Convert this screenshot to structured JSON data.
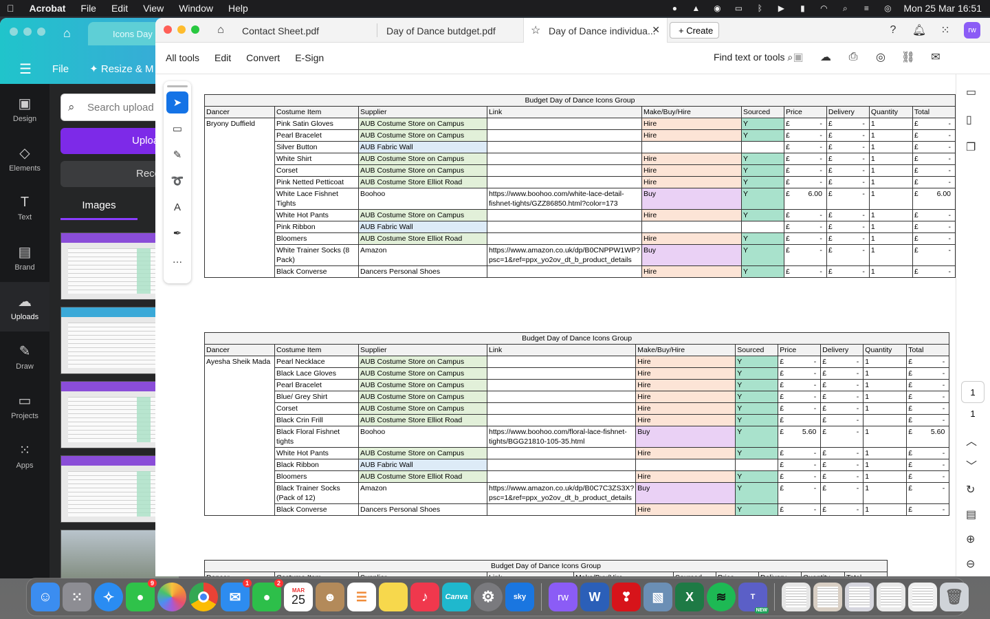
{
  "menubar": {
    "apple": "",
    "app": "Acrobat",
    "items": [
      "File",
      "Edit",
      "View",
      "Window",
      "Help"
    ],
    "datetime": "Mon 25 Mar  16:51"
  },
  "canva": {
    "tab": "Icons Day",
    "file": "File",
    "resize": "Resize & M",
    "search_placeholder": "Search upload",
    "upload": "Uploa",
    "record": "Reco",
    "images_tab": "Images",
    "sidebar": [
      {
        "label": "Design",
        "icon": "design-icon"
      },
      {
        "label": "Elements",
        "icon": "elements-icon"
      },
      {
        "label": "Text",
        "icon": "text-icon"
      },
      {
        "label": "Brand",
        "icon": "brand-icon"
      },
      {
        "label": "Uploads",
        "icon": "uploads-icon"
      },
      {
        "label": "Draw",
        "icon": "draw-icon"
      },
      {
        "label": "Projects",
        "icon": "projects-icon"
      },
      {
        "label": "Apps",
        "icon": "apps-icon"
      }
    ]
  },
  "acrobat": {
    "tabs": [
      "Contact Sheet.pdf",
      "Day of Dance butdget.pdf",
      "Day of Dance individua..."
    ],
    "create": "Create",
    "menus": [
      "All tools",
      "Edit",
      "Convert",
      "E-Sign"
    ],
    "find": "Find text or tools",
    "avatar": "rw",
    "page_current": "1",
    "page_total": "1"
  },
  "colors": {
    "supplier_store": "#e2f0d9",
    "supplier_fabric": "#ddebf7",
    "hire": "#fce4d6",
    "buy": "#ead1f5",
    "sourced": "#a9e2cc"
  },
  "document": {
    "headers": [
      "Dancer",
      "Costume Item",
      "Supplier",
      "Link",
      "Make/Buy/Hire",
      "Sourced",
      "Price",
      "Delivery",
      "Quantity",
      "Total"
    ],
    "tables": [
      {
        "title": "Budget Day of Dance Icons Group",
        "dancer": "Bryony Duffield",
        "rows": [
          {
            "item": "Pink Satin Gloves",
            "supplier": "AUB Costume Store on Campus",
            "link": "",
            "mbh": "Hire",
            "sourced": "Y",
            "price": "-",
            "delivery": "-",
            "qty": "1",
            "total": "-"
          },
          {
            "item": "Pearl Bracelet",
            "supplier": "AUB Costume Store on Campus",
            "link": "",
            "mbh": "Hire",
            "sourced": "Y",
            "price": "-",
            "delivery": "-",
            "qty": "1",
            "total": "-"
          },
          {
            "item": "Silver Button",
            "supplier": "AUB Fabric Wall",
            "link": "",
            "mbh": "",
            "sourced": "",
            "price": "-",
            "delivery": "-",
            "qty": "1",
            "total": "-"
          },
          {
            "item": "White Shirt",
            "supplier": "AUB Costume Store on Campus",
            "link": "",
            "mbh": "Hire",
            "sourced": "Y",
            "price": "-",
            "delivery": "-",
            "qty": "1",
            "total": "-"
          },
          {
            "item": "Corset",
            "supplier": "AUB Costume Store on Campus",
            "link": "",
            "mbh": "Hire",
            "sourced": "Y",
            "price": "-",
            "delivery": "-",
            "qty": "1",
            "total": "-"
          },
          {
            "item": "Pink Netted Petticoat",
            "supplier": "AUB Costume Store Elliot Road",
            "link": "",
            "mbh": "Hire",
            "sourced": "Y",
            "price": "-",
            "delivery": "-",
            "qty": "1",
            "total": "-"
          },
          {
            "item": "White Lace Fishnet Tights",
            "supplier": "Boohoo",
            "link": "https://www.boohoo.com/white-lace-detail-fishnet-tights/GZZ86850.html?color=173",
            "mbh": "Buy",
            "sourced": "Y",
            "price": "6.00",
            "delivery": "-",
            "qty": "1",
            "total": "6.00"
          },
          {
            "item": "White Hot Pants",
            "supplier": "AUB Costume Store on Campus",
            "link": "",
            "mbh": "Hire",
            "sourced": "Y",
            "price": "-",
            "delivery": "-",
            "qty": "1",
            "total": "-"
          },
          {
            "item": "Pink Ribbon",
            "supplier": "AUB Fabric Wall",
            "link": "",
            "mbh": "",
            "sourced": "",
            "price": "-",
            "delivery": "-",
            "qty": "1",
            "total": "-"
          },
          {
            "item": "Bloomers",
            "supplier": "AUB Costume Store Elliot Road",
            "link": "",
            "mbh": "Hire",
            "sourced": "Y",
            "price": "-",
            "delivery": "-",
            "qty": "1",
            "total": "-"
          },
          {
            "item": "White Trainer Socks (8 Pack)",
            "supplier": "Amazon",
            "link": "https://www.amazon.co.uk/dp/B0CNPPW1WP?psc=1&ref=ppx_yo2ov_dt_b_product_details",
            "mbh": "Buy",
            "sourced": "Y",
            "price": "-",
            "delivery": "-",
            "qty": "1",
            "total": "-"
          },
          {
            "item": "Black Converse",
            "supplier": "Dancers Personal Shoes",
            "link": "",
            "mbh": "Hire",
            "sourced": "Y",
            "price": "-",
            "delivery": "-",
            "qty": "1",
            "total": "-"
          }
        ]
      },
      {
        "title": "Budget Day of Dance Icons Group",
        "dancer": "Ayesha Sheik Mada",
        "rows": [
          {
            "item": "Pearl Necklace",
            "supplier": "AUB Costume Store on Campus",
            "link": "",
            "mbh": "Hire",
            "sourced": "Y",
            "price": "-",
            "delivery": "-",
            "qty": "1",
            "total": "-"
          },
          {
            "item": "Black Lace Gloves",
            "supplier": "AUB Costume Store on Campus",
            "link": "",
            "mbh": "Hire",
            "sourced": "Y",
            "price": "-",
            "delivery": "-",
            "qty": "1",
            "total": "-"
          },
          {
            "item": "Pearl Bracelet",
            "supplier": "AUB Costume Store on Campus",
            "link": "",
            "mbh": "Hire",
            "sourced": "Y",
            "price": "-",
            "delivery": "-",
            "qty": "1",
            "total": "-"
          },
          {
            "item": "Blue/ Grey Shirt",
            "supplier": "AUB Costume Store on Campus",
            "link": "",
            "mbh": "Hire",
            "sourced": "Y",
            "price": "-",
            "delivery": "-",
            "qty": "1",
            "total": "-"
          },
          {
            "item": "Corset",
            "supplier": "AUB Costume Store on Campus",
            "link": "",
            "mbh": "Hire",
            "sourced": "Y",
            "price": "-",
            "delivery": "-",
            "qty": "1",
            "total": "-"
          },
          {
            "item": "Black Crin Frill",
            "supplier": "AUB Costume Store Elliot Road",
            "link": "",
            "mbh": "Hire",
            "sourced": "Y",
            "price": "",
            "delivery": "-",
            "qty": "",
            "total": "-"
          },
          {
            "item": "Black Floral Fishnet tights",
            "supplier": "Boohoo",
            "link": "https://www.boohoo.com/floral-lace-fishnet-tights/BGG21810-105-35.html",
            "mbh": "Buy",
            "sourced": "Y",
            "price": "5.60",
            "delivery": "-",
            "qty": "1",
            "total": "5.60"
          },
          {
            "item": "White Hot Pants",
            "supplier": "AUB Costume Store on Campus",
            "link": "",
            "mbh": "Hire",
            "sourced": "Y",
            "price": "-",
            "delivery": "-",
            "qty": "1",
            "total": "-"
          },
          {
            "item": "Black Ribbon",
            "supplier": "AUB Fabric Wall",
            "link": "",
            "mbh": "",
            "sourced": "",
            "price": "-",
            "delivery": "-",
            "qty": "1",
            "total": "-"
          },
          {
            "item": "Bloomers",
            "supplier": "AUB Costume Store Elliot Road",
            "link": "",
            "mbh": "Hire",
            "sourced": "Y",
            "price": "-",
            "delivery": "-",
            "qty": "1",
            "total": "-"
          },
          {
            "item": "Black Trainer Socks (Pack of 12)",
            "supplier": "Amazon",
            "link": "https://www.amazon.co.uk/dp/B0C7C3ZS3X?psc=1&ref=ppx_yo2ov_dt_b_product_details",
            "mbh": "Buy",
            "sourced": "Y",
            "price": "-",
            "delivery": "-",
            "qty": "1",
            "total": "-"
          },
          {
            "item": "Black Converse",
            "supplier": "Dancers Personal Shoes",
            "link": "",
            "mbh": "Hire",
            "sourced": "Y",
            "price": "-",
            "delivery": "-",
            "qty": "1",
            "total": "-"
          }
        ]
      },
      {
        "title": "Budget Day of Dance Icons Group",
        "dancer": "",
        "rows": []
      }
    ],
    "currency": "£"
  },
  "dock": {
    "items": [
      {
        "name": "finder",
        "color": "#3b8df0"
      },
      {
        "name": "launchpad",
        "color": "#8d8d93"
      },
      {
        "name": "safari",
        "color": "#2a8cf2"
      },
      {
        "name": "messages",
        "color": "#2fc24a",
        "badge": "9"
      },
      {
        "name": "photos",
        "color": "#f0a73a"
      },
      {
        "name": "chrome",
        "color": "#e94235"
      },
      {
        "name": "mail",
        "color": "#2d8cf0",
        "badge": "1"
      },
      {
        "name": "facetime",
        "color": "#2dbf4a",
        "badge": "2"
      },
      {
        "name": "calendar",
        "color": "#ffffff"
      },
      {
        "name": "contacts",
        "color": "#b38a5a"
      },
      {
        "name": "reminders",
        "color": "#ffffff"
      },
      {
        "name": "notes",
        "color": "#f7d84c"
      },
      {
        "name": "music",
        "color": "#f0384d"
      },
      {
        "name": "canva",
        "color": "#1fb8cd"
      },
      {
        "name": "system-settings",
        "color": "#7a7a7e"
      },
      {
        "name": "sky-go",
        "color": "#1a76e0"
      },
      {
        "name": "rw-app",
        "color": "#8b5cf6"
      },
      {
        "name": "word",
        "color": "#2b5fb8"
      },
      {
        "name": "acrobat",
        "color": "#d7141a"
      },
      {
        "name": "preview",
        "color": "#6b8fb5"
      },
      {
        "name": "excel",
        "color": "#1e7a45"
      },
      {
        "name": "spotify",
        "color": "#1db954"
      },
      {
        "name": "teams",
        "color": "#5b5fc7"
      },
      {
        "name": "doc-stack-1",
        "color": "#e6e6e6"
      },
      {
        "name": "doc-stack-2",
        "color": "#d9cfc4"
      },
      {
        "name": "doc-stack-3",
        "color": "#d6d6de"
      },
      {
        "name": "doc-stack-4",
        "color": "#e9e9e9"
      },
      {
        "name": "doc-stack-5",
        "color": "#efefef"
      },
      {
        "name": "trash",
        "color": "#cfd3d8"
      }
    ],
    "calendar_month": "MAR",
    "calendar_day": "25",
    "sky": "sky",
    "canva": "Canva",
    "teams_new": "NEW",
    "rw": "rw"
  }
}
